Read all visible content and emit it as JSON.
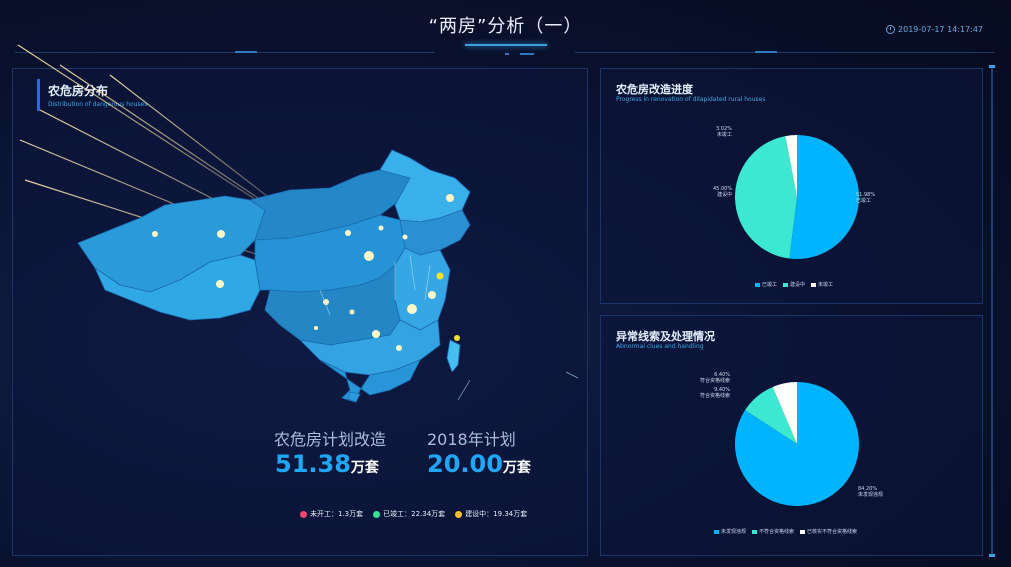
{
  "header": {
    "title": "“两房”分析（一）",
    "datetime": "2019-07-17 14:17:47"
  },
  "map_panel": {
    "title": "农危房分布",
    "subtitle": "Distribution of dangerous houses",
    "stat1": {
      "label": "农危房计划改造",
      "value": "51.38",
      "unit": "万套"
    },
    "stat2": {
      "label": "2018年计划",
      "value": "20.00",
      "unit": "万套"
    },
    "legend": [
      {
        "label": "未开工：1.3万套",
        "color": "#f2466e"
      },
      {
        "label": "已竣工：22.34万套",
        "color": "#35e29a"
      },
      {
        "label": "建设中：19.34万套",
        "color": "#f5c12b"
      }
    ]
  },
  "progress_panel": {
    "title": "农危房改造进度",
    "subtitle": "Progress in renovation of dilapidated rural houses",
    "chart_data": {
      "type": "pie",
      "categories": [
        "已竣工",
        "建设中",
        "未竣工"
      ],
      "values": [
        51.98,
        45.0,
        3.02
      ],
      "colors": [
        "#00b4ff",
        "#3de8d0",
        "#ffffff"
      ],
      "labels": [
        "51.98%",
        "45.00%",
        "3.02%"
      ]
    },
    "legend": [
      "已竣工",
      "建设中",
      "未竣工"
    ]
  },
  "abnormal_panel": {
    "title": "异常线索及处理情况",
    "subtitle": "Abnormal clues and handling",
    "chart_data": {
      "type": "pie",
      "categories": [
        "未发现违规",
        "不符合资格线索",
        "已核实不符合资格线索"
      ],
      "values": [
        84.2,
        9.4,
        6.4
      ],
      "colors": [
        "#00b4ff",
        "#3de8d0",
        "#ffffff"
      ],
      "labels": [
        "84.20%",
        "9.40%",
        "6.40%"
      ],
      "slice_label_text": [
        "未发现违规",
        "符合资格线索",
        "符合资格线索"
      ]
    },
    "legend": [
      "未发现违规",
      "不符合资格线索",
      "已核实不符合资格线索"
    ]
  }
}
